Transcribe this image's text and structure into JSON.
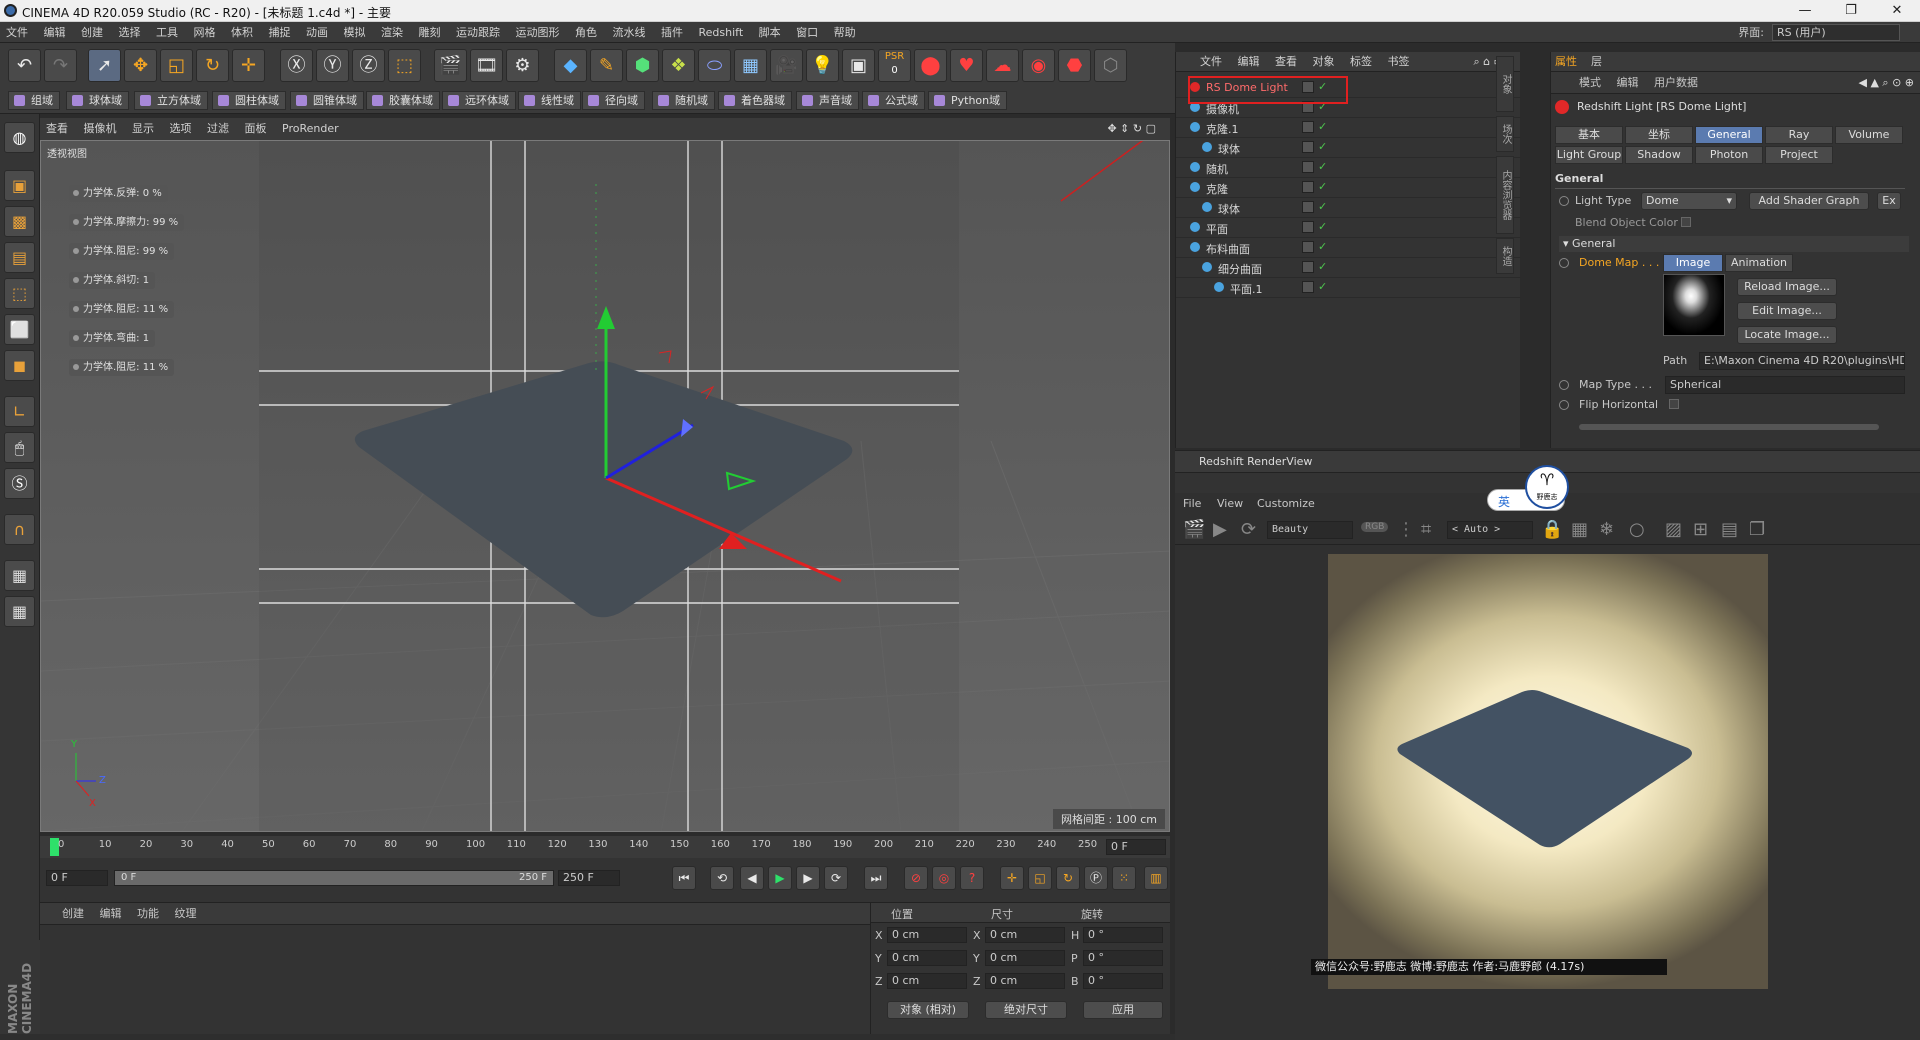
{
  "window": {
    "title": "CINEMA 4D R20.059 Studio (RC - R20) - [未标题 1.c4d *] - 主要",
    "controls": [
      "—",
      "❐",
      "✕"
    ]
  },
  "menubar": {
    "items": [
      "文件",
      "编辑",
      "创建",
      "选择",
      "工具",
      "网格",
      "体积",
      "捕捉",
      "动画",
      "模拟",
      "渲染",
      "雕刻",
      "运动跟踪",
      "运动图形",
      "角色",
      "流水线",
      "插件",
      "Redshift",
      "脚本",
      "窗口",
      "帮助"
    ],
    "layout_label": "界面:",
    "layout_value": "RS (用户)"
  },
  "toolbar": {
    "psr_label": "PSR",
    "psr_value": "0"
  },
  "fieldbar": {
    "items": [
      "组域",
      "球体域",
      "立方体域",
      "圆柱体域",
      "圆锥体域",
      "胶囊体域",
      "远环体域",
      "线性域",
      "径向域",
      "随机域",
      "着色器域",
      "声音域",
      "公式域",
      "Python域"
    ]
  },
  "viewport": {
    "menu": [
      "查看",
      "摄像机",
      "显示",
      "选项",
      "过滤",
      "面板",
      "ProRender"
    ],
    "label": "透视视图",
    "grid_spacing": "网格间距 : 100 cm",
    "params": [
      "力学体.反弹:  0 %",
      "力学体.摩擦力:  99 %",
      "力学体.阻尼:  99 %",
      "力学体.斜切:  1",
      "力学体.阻尼:  11 %",
      "力学体.弯曲:  1",
      "力学体.阻尼:  11 %"
    ],
    "axis": {
      "y": "Y",
      "z": "Z",
      "x": "X"
    }
  },
  "timeline": {
    "ticks": [
      "0",
      "10",
      "20",
      "30",
      "40",
      "50",
      "60",
      "70",
      "80",
      "90",
      "100",
      "110",
      "120",
      "130",
      "140",
      "150",
      "160",
      "170",
      "180",
      "190",
      "200",
      "210",
      "220",
      "230",
      "240",
      "250"
    ],
    "current_frame": "0 F",
    "start": "0 F",
    "slider_start": "0 F",
    "slider_end": "250 F",
    "end": "250 F"
  },
  "material": {
    "menu": [
      "创建",
      "编辑",
      "功能",
      "纹理"
    ]
  },
  "coords": {
    "headers": [
      "位置",
      "尺寸",
      "旋转"
    ],
    "rows": [
      {
        "a": "X",
        "av": "0 cm",
        "b": "X",
        "bv": "0 cm",
        "c": "H",
        "cv": "0 °"
      },
      {
        "a": "Y",
        "av": "0 cm",
        "b": "Y",
        "bv": "0 cm",
        "c": "P",
        "cv": "0 °"
      },
      {
        "a": "Z",
        "av": "0 cm",
        "b": "Z",
        "bv": "0 cm",
        "c": "B",
        "cv": "0 °"
      }
    ],
    "mode1": "对象 (相对)",
    "mode2": "绝对尺寸",
    "apply": "应用"
  },
  "objects": {
    "menu": [
      "文件",
      "编辑",
      "查看",
      "对象",
      "标签",
      "书签"
    ],
    "side_tabs": [
      "对象",
      "场次",
      "内容浏览器",
      "构造"
    ],
    "rows": [
      {
        "name": "RS Dome Light",
        "indent": 0,
        "color": "#ff6b6b"
      },
      {
        "name": "摄像机",
        "indent": 0,
        "color": "#d8d8d8"
      },
      {
        "name": "克隆.1",
        "indent": 0,
        "color": "#d8d8d8"
      },
      {
        "name": "球体",
        "indent": 1,
        "color": "#d8d8d8"
      },
      {
        "name": "随机",
        "indent": 0,
        "color": "#d8d8d8"
      },
      {
        "name": "克隆",
        "indent": 0,
        "color": "#d8d8d8"
      },
      {
        "name": "球体",
        "indent": 1,
        "color": "#d8d8d8"
      },
      {
        "name": "平面",
        "indent": 0,
        "color": "#d8d8d8"
      },
      {
        "name": "布料曲面",
        "indent": 0,
        "color": "#d8d8d8"
      },
      {
        "name": "细分曲面",
        "indent": 1,
        "color": "#d8d8d8"
      },
      {
        "name": "平面.1",
        "indent": 2,
        "color": "#d8d8d8"
      }
    ]
  },
  "attributes": {
    "title": "属性",
    "side_tab": "层",
    "menu": [
      "模式",
      "编辑",
      "用户数据"
    ],
    "object_title": "Redshift Light [RS Dome Light]",
    "tabs_row1": [
      "基本",
      "坐标",
      "General",
      "Ray",
      "Volume"
    ],
    "tabs_row2": [
      "Light Group",
      "Shadow",
      "Photon",
      "Project"
    ],
    "section": "General",
    "light_type_label": "Light Type",
    "light_type_value": "Dome",
    "add_shader_graph": "Add Shader Graph",
    "ex_btn": "Ex",
    "blend_label": "Blend Object Color",
    "sub_section": "General",
    "dome_map_label": "Dome Map . . .",
    "image_tab": "Image",
    "animation_tab": "Animation",
    "reload": "Reload Image...",
    "edit": "Edit Image...",
    "locate": "Locate Image...",
    "path_label": "Path",
    "path_value": "E:\\Maxon Cinema 4D R20\\plugins\\HDR",
    "map_type_label": "Map Type . . .",
    "map_type_value": "Spherical",
    "flip_label": "Flip Horizontal"
  },
  "render": {
    "title": "Redshift RenderView",
    "menu": [
      "File",
      "View",
      "Customize"
    ],
    "aov": "Beauty",
    "rgb": "RGB",
    "zoom": "< Auto >",
    "ime": "英",
    "watermark_badge": "野鹿志",
    "footer": "微信公众号:野鹿志  微博:野鹿志  作者:马鹿野郎 (4.17s)"
  }
}
